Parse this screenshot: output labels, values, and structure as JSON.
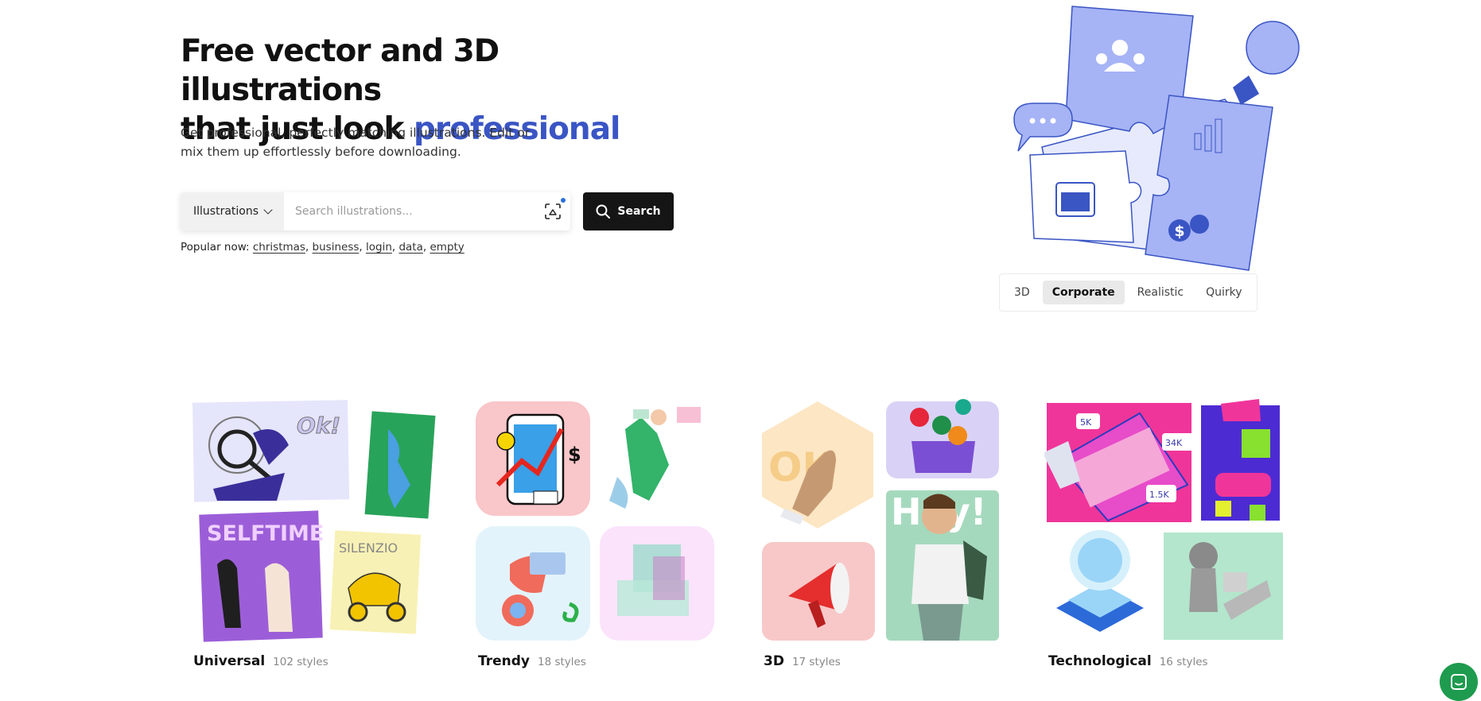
{
  "hero": {
    "title_line1": "Free vector and 3D illustrations",
    "title_line2_prefix": "that just look ",
    "title_line2_accent": "professional",
    "subtitle": "Get professional, perfectly matching illustrations. Edit or mix them up effortlessly before downloading."
  },
  "search": {
    "dropdown_label": "Illustrations",
    "placeholder": "Search illustrations...",
    "value": "",
    "button_label": "Search"
  },
  "popular": {
    "label": "Popular now: ",
    "tags": [
      "christmas",
      "business",
      "login",
      "data",
      "empty"
    ]
  },
  "style_tabs": {
    "items": [
      "3D",
      "Corporate",
      "Realistic",
      "Quirky"
    ],
    "active": "Corporate"
  },
  "categories": [
    {
      "name": "Universal",
      "count": "102 styles"
    },
    {
      "name": "Trendy",
      "count": "18 styles"
    },
    {
      "name": "3D",
      "count": "17 styles"
    },
    {
      "name": "Technological",
      "count": "16 styles"
    }
  ],
  "art_text": {
    "ok": "Ok!",
    "selftime": "SELFTIME",
    "silenzio": "SILENZIO",
    "hey": "Hey!",
    "ok3d": "OK",
    "views": "34K",
    "likes": "1.5K",
    "comments": "5K"
  },
  "colors": {
    "accent": "#3a55c4",
    "search_button": "#151515",
    "chat_button": "#1e9b4e",
    "puzzle": "#a6b3f5"
  }
}
